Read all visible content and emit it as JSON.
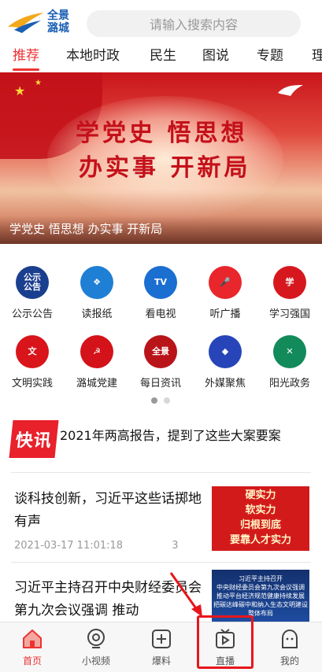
{
  "header": {
    "logo_text_1": "全景",
    "logo_text_2": "潞城",
    "search_placeholder": "请输入搜索内容"
  },
  "tabs": [
    {
      "label": "推荐",
      "active": true
    },
    {
      "label": "本地时政"
    },
    {
      "label": "民生"
    },
    {
      "label": "图说"
    },
    {
      "label": "专题"
    },
    {
      "label": "理"
    }
  ],
  "banner": {
    "line1": "学党史 悟思想",
    "line2": "办实事 开新局",
    "caption": "学党史 悟思想 办实事 开新局"
  },
  "grid": [
    {
      "label": "公示公告",
      "icon": "notice-icon",
      "color": "#1b3f8f",
      "glyph": "公示\n公告"
    },
    {
      "label": "读报纸",
      "icon": "dropbox-icon",
      "color": "#1f7fd4",
      "glyph": "❖"
    },
    {
      "label": "看电视",
      "icon": "tv-icon",
      "color": "#1a6fd0",
      "glyph": "TV"
    },
    {
      "label": "听广播",
      "icon": "microphone-icon",
      "color": "#e8262b",
      "glyph": "🎤"
    },
    {
      "label": "学习强国",
      "icon": "xuexi-icon",
      "color": "#d6181e",
      "glyph": "学"
    },
    {
      "label": "文明实践",
      "icon": "civilization-icon",
      "color": "#d9141b",
      "glyph": "文"
    },
    {
      "label": "潞城党建",
      "icon": "party-emblem-icon",
      "color": "#d4121a",
      "glyph": "☭"
    },
    {
      "label": "每日资讯",
      "icon": "daily-news-icon",
      "color": "#b8141a",
      "glyph": "全景"
    },
    {
      "label": "外媒聚焦",
      "icon": "cube-icon",
      "color": "#2745b8",
      "glyph": "◆"
    },
    {
      "label": "阳光政务",
      "icon": "sunshine-gov-icon",
      "color": "#138a5a",
      "glyph": "✕"
    }
  ],
  "pager": {
    "active_color": "#9a9a9a",
    "inactive_color": "#d8d8d8"
  },
  "flash": {
    "badge": "快讯",
    "text": "2021年两高报告，提到了这些大案要案"
  },
  "articles": [
    {
      "title": "谈科技创新，习近平这些话掷地有声",
      "date": "2021-03-17 11:01:18",
      "count": "3",
      "thumb_lines": [
        "硬实力",
        "软实力",
        "归根到底",
        "要靠人才实力"
      ]
    },
    {
      "title": "习近平主持召开中央财经委员会第九次会议强调 推动",
      "thumb_lines": [
        "习近平主持召开",
        "中央财经委员会第九次会议强调",
        "推动平台经济规范健康持续发展",
        "把碳达峰碳中和纳入生态文明建设整体布局"
      ]
    }
  ],
  "bottom_nav": [
    {
      "label": "首页",
      "icon": "home-icon",
      "active": true
    },
    {
      "label": "小视频",
      "icon": "camera-icon"
    },
    {
      "label": "爆料",
      "icon": "plus-box-icon"
    },
    {
      "label": "直播",
      "icon": "live-tv-icon"
    },
    {
      "label": "我的",
      "icon": "profile-icon"
    }
  ],
  "colors": {
    "accent": "#e33333",
    "highlight_box": "#e8151b"
  }
}
